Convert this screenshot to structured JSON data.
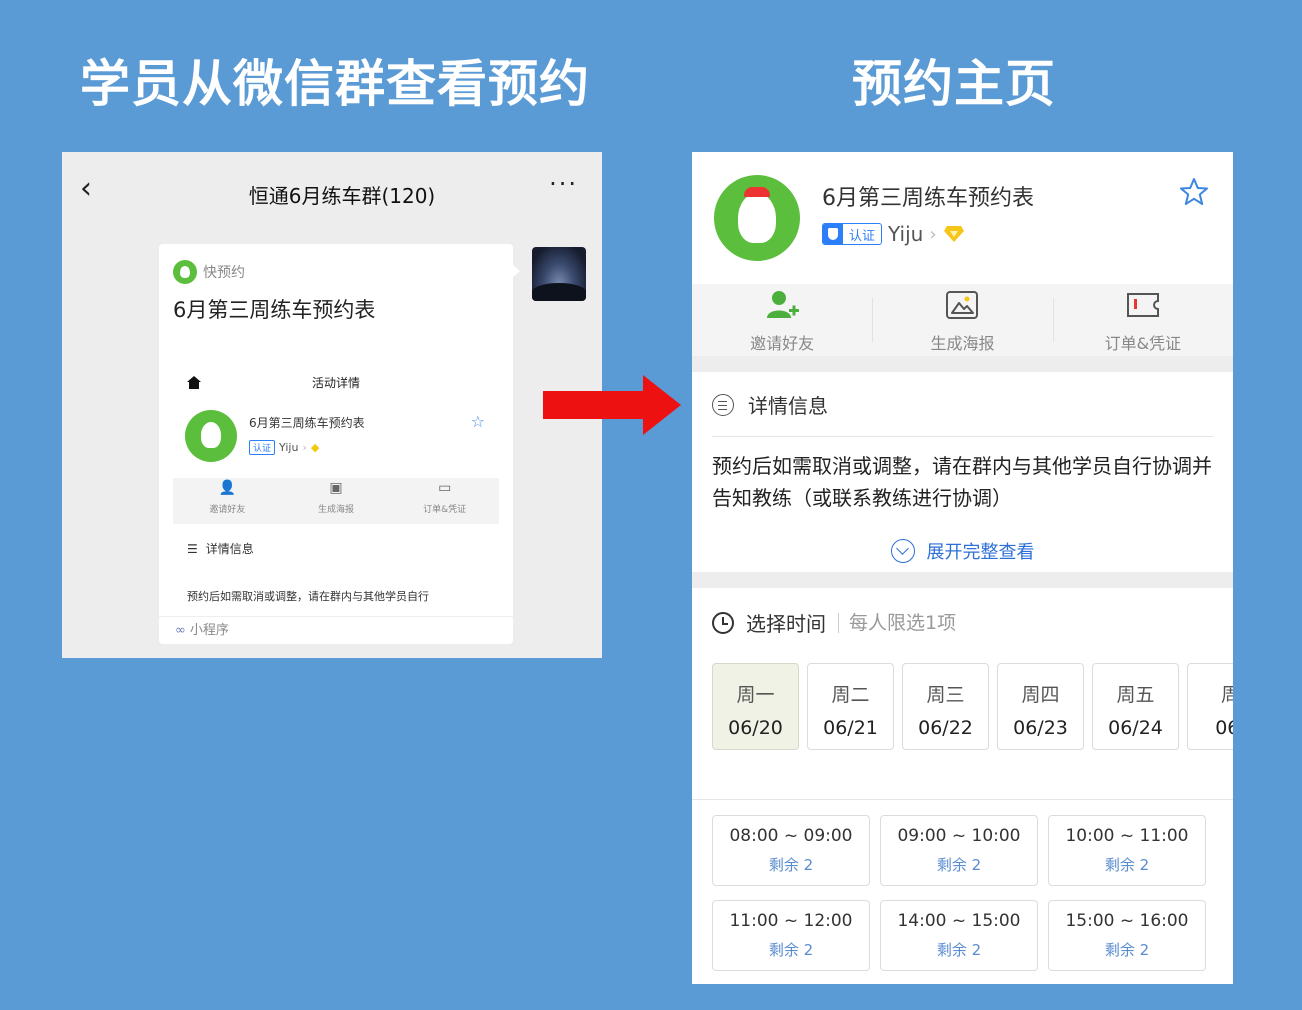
{
  "headings": {
    "left": "学员从微信群查看预约",
    "right": "预约主页"
  },
  "chat": {
    "title": "恒通6月练车群(120)",
    "back_icon": "‹",
    "more_icon": "···",
    "card": {
      "source": "快预约",
      "title": "6月第三周练车预约表",
      "footer": "小程序",
      "preview": {
        "topbar": "活动详情",
        "name": "6月第三周练车预约表",
        "cert": "认证",
        "org": "Yiju",
        "actions": [
          "邀请好友",
          "生成海报",
          "订单&凭证"
        ],
        "detail": "详情信息",
        "text": "预约后如需取消或调整，请在群内与其他学员自行"
      }
    }
  },
  "booking": {
    "title": "6月第三周练车预约表",
    "cert_label": "认证",
    "org": "Yiju",
    "actions": [
      "邀请好友",
      "生成海报",
      "订单&凭证"
    ],
    "detail_heading": "详情信息",
    "description": "预约后如需取消或调整，请在群内与其他学员自行协调并告知教练（或联系教练进行协调）",
    "expand": "展开完整查看",
    "time_heading": "选择时间",
    "time_sub": "每人限选1项",
    "days": [
      {
        "week": "周一",
        "date": "06/20"
      },
      {
        "week": "周二",
        "date": "06/21"
      },
      {
        "week": "周三",
        "date": "06/22"
      },
      {
        "week": "周四",
        "date": "06/23"
      },
      {
        "week": "周五",
        "date": "06/24"
      },
      {
        "week": "周",
        "date": "06/"
      }
    ],
    "selected_day_index": 0,
    "slots": [
      {
        "time": "08:00 ~ 09:00",
        "left": "剩余 2"
      },
      {
        "time": "09:00 ~ 10:00",
        "left": "剩余 2"
      },
      {
        "time": "10:00 ~ 11:00",
        "left": "剩余 2"
      },
      {
        "time": "11:00 ~ 12:00",
        "left": "剩余 2"
      },
      {
        "time": "14:00 ~ 15:00",
        "left": "剩余 2"
      },
      {
        "time": "15:00 ~ 16:00",
        "left": "剩余 2"
      }
    ]
  },
  "colors": {
    "background": "#5b9bd5",
    "brand_green": "#5bbe3c",
    "accent_blue": "#2d6fd6",
    "arrow_red": "#ee1111"
  },
  "icons": [
    "back-icon",
    "more-icon",
    "star-icon",
    "invite-icon",
    "poster-icon",
    "ticket-icon",
    "list-icon",
    "clock-icon",
    "expand-icon",
    "diamond-icon",
    "miniprogram-icon"
  ]
}
